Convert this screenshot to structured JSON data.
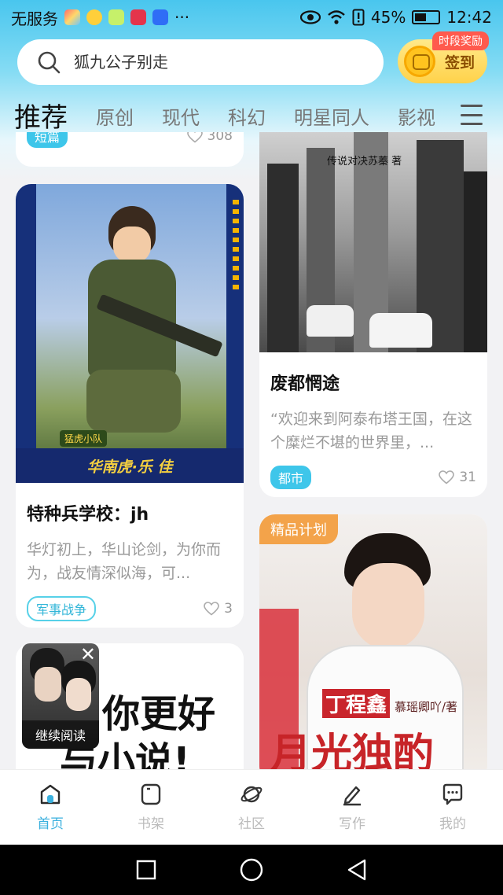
{
  "status_bar": {
    "carrier": "无服务",
    "battery": "45%",
    "time": "12:42",
    "more": "···"
  },
  "search": {
    "placeholder": "狐九公子别走"
  },
  "signin": {
    "label": "签到",
    "badge": "时段奖励"
  },
  "tabs": [
    "推荐",
    "原创",
    "现代",
    "科幻",
    "明星同人",
    "影视"
  ],
  "cards": {
    "top_left": {
      "tag": "短篇",
      "likes": "308"
    },
    "left_1": {
      "cover_caption": "华南虎·乐 佳",
      "cover_badge": "猛虎小队",
      "title": "特种兵学校：jh",
      "desc": "华灯初上，华山论剑，为你而为，战友情深似海，可...",
      "tag": "军事战争",
      "likes": "3"
    },
    "left_2": {
      "cover_text_1": "你更好",
      "cover_text_2": "与小说!"
    },
    "right_1": {
      "cover_author": "传说对决苏蓁 著",
      "title": "废都惘途",
      "desc": "“欢迎来到阿泰布塔王国，在这个糜烂不堪的世界里，...",
      "tag": "都市",
      "likes": "31"
    },
    "right_2": {
      "badge": "精品计划",
      "cover_name": "丁程鑫",
      "cover_author": "慕瑶卿吖/著",
      "cover_title": "月光独酌"
    }
  },
  "continue_reading": {
    "label": "继续阅读"
  },
  "bottom_nav": [
    {
      "label": "首页",
      "icon": "home-icon",
      "active": true
    },
    {
      "label": "书架",
      "icon": "bookshelf-icon",
      "active": false
    },
    {
      "label": "社区",
      "icon": "planet-icon",
      "active": false
    },
    {
      "label": "写作",
      "icon": "pen-icon",
      "active": false
    },
    {
      "label": "我的",
      "icon": "chat-icon",
      "active": false
    }
  ],
  "colors": {
    "accent": "#3ab0de",
    "tag": "#3ec6ea",
    "premium": "#f3a34a"
  }
}
